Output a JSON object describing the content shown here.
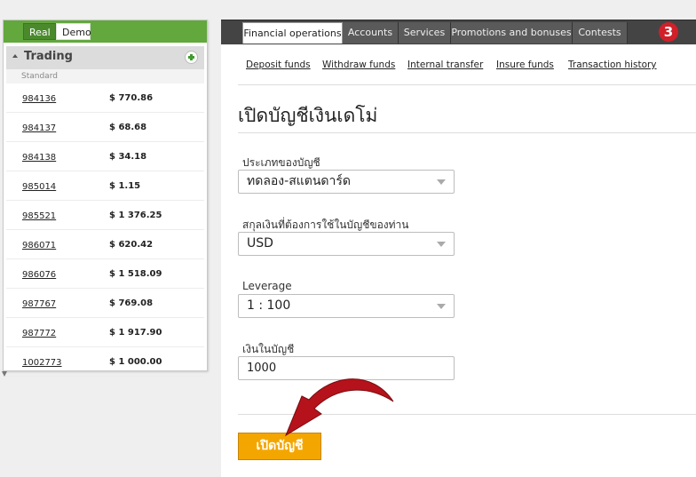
{
  "left_panel": {
    "mode_tabs": [
      {
        "label": "Real"
      },
      {
        "label": "Demo"
      }
    ],
    "section_title": "Trading",
    "group_label": "Standard",
    "accounts": [
      {
        "number": "984136",
        "balance": "$ 770.86"
      },
      {
        "number": "984137",
        "balance": "$ 68.68"
      },
      {
        "number": "984138",
        "balance": "$ 34.18"
      },
      {
        "number": "985014",
        "balance": "$ 1.15"
      },
      {
        "number": "985521",
        "balance": "$ 1 376.25"
      },
      {
        "number": "986071",
        "balance": "$ 620.42"
      },
      {
        "number": "986076",
        "balance": "$ 1 518.09"
      },
      {
        "number": "987767",
        "balance": "$ 769.08"
      },
      {
        "number": "987772",
        "balance": "$ 1 917.90"
      },
      {
        "number": "1002773",
        "balance": "$ 1 000.00"
      }
    ]
  },
  "top_nav": {
    "tabs": [
      {
        "label": "Financial operations"
      },
      {
        "label": "Accounts"
      },
      {
        "label": "Services"
      },
      {
        "label": "Promotions and bonuses"
      },
      {
        "label": "Contests"
      }
    ],
    "badge": "3"
  },
  "subnav": {
    "links": [
      {
        "label": "Deposit funds"
      },
      {
        "label": "Withdraw funds"
      },
      {
        "label": "Internal transfer"
      },
      {
        "label": "Insure funds"
      },
      {
        "label": "Transaction history"
      }
    ]
  },
  "form": {
    "title": "เปิดบัญชีเงินเดโม่",
    "account_type": {
      "label": "ประเภทของบัญชี",
      "value": "ทดลอง-สแตนดาร์ด"
    },
    "currency": {
      "label": "สกุลเงินที่ต้องการใช้ในบัญชีของท่าน",
      "value": "USD"
    },
    "leverage": {
      "label": "Leverage",
      "value": "1 : 100"
    },
    "deposit": {
      "label": "เงินในบัญชี",
      "value": "1000"
    },
    "submit_label": "เปิดบัญชี"
  },
  "colors": {
    "mode_bar_green": "#62a83d",
    "nav_dark": "#444444",
    "badge_red": "#d0202a",
    "button_orange": "#f4a600",
    "pointer_red": "#b5121b"
  }
}
